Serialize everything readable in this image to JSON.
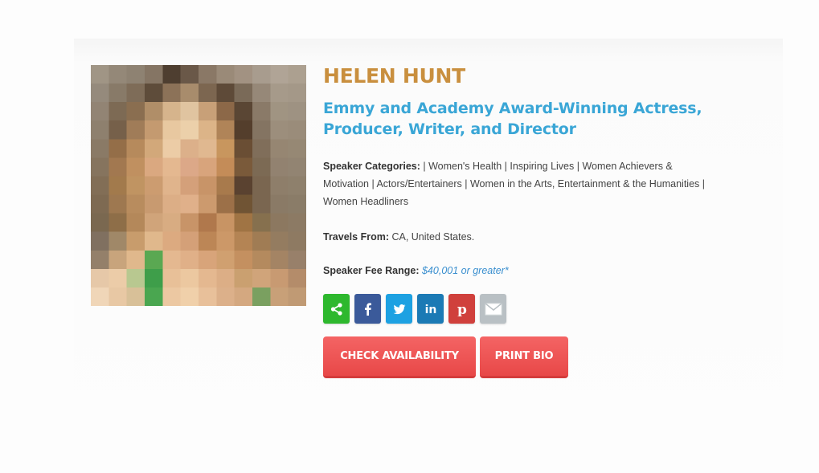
{
  "speaker": {
    "name": "HELEN HUNT",
    "headline_line1": "Emmy and Academy Award-Winning Actress,",
    "headline_line2": "Producer, Writer, and Director",
    "categories_label": "Speaker Categories:",
    "categories_line1": " | Women's Health | Inspiring Lives | Women Achievers &",
    "categories_line2": "Motivation | Actors/Entertainers | Women in the Arts, Entertainment & the Humanities |",
    "categories_line3": "Women Headliners",
    "travels_label": "Travels From:",
    "travels_value": " CA, United States.",
    "fee_label": "Speaker Fee Range:",
    "fee_value": "$40,001 or greater*"
  },
  "social": {
    "share_color": "#2eb82e",
    "facebook_color": "#3b5a9a",
    "twitter_color": "#1da1e2",
    "linkedin_color": "#1b7ab5",
    "pinterest_color": "#d0403c",
    "email_color": "#b9c0c4",
    "icons": [
      "share-icon",
      "facebook-icon",
      "twitter-icon",
      "linkedin-icon",
      "pinterest-icon",
      "email-icon"
    ]
  },
  "actions": {
    "check_availability": "CHECK AVAILABILITY",
    "print_bio": "PRINT BIO"
  },
  "colors": {
    "name": "#c98f3e",
    "headline": "#3aa6d6",
    "fee": "#3a8fcf",
    "button": "#ee5454"
  }
}
